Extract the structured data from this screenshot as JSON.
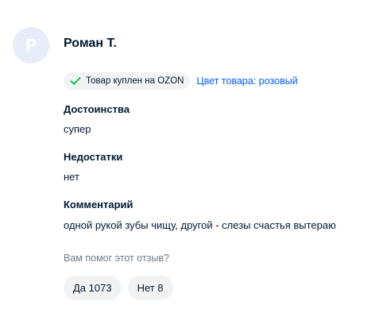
{
  "review": {
    "avatar_letter": "Р",
    "author_name": "Роман Т.",
    "purchased_badge": "Товар куплен на OZON",
    "product_color": "Цвет товара: розовый",
    "pros_title": "Достоинства",
    "pros_text": "супер",
    "cons_title": "Недостатки",
    "cons_text": "нет",
    "comment_title": "Комментарий",
    "comment_text": "одной рукой зубы чищу, другой - слезы счастья вытераю"
  },
  "helpful": {
    "question": "Вам помог этот отзыв?",
    "yes_label": "Да 1073",
    "no_label": "Нет 8"
  },
  "colors": {
    "avatar_bg": "#e6ecf8",
    "check_green": "#10c44c",
    "link_blue": "#005bff",
    "chip_bg": "#f2f3f5",
    "muted_text": "#6d7988"
  },
  "icons": {
    "check": "check-icon"
  }
}
